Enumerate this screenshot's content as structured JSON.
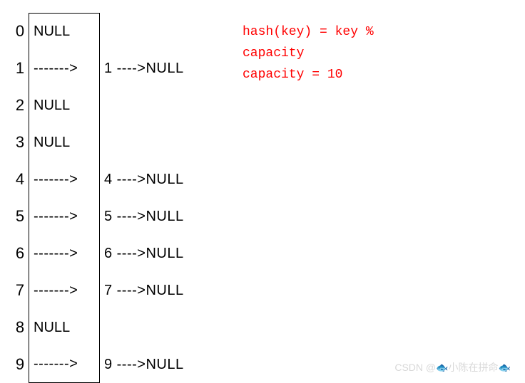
{
  "table": {
    "buckets": [
      {
        "index": "0",
        "content": "NULL",
        "has_chain": false
      },
      {
        "index": "1",
        "content": "",
        "has_chain": true,
        "arrow_in": "------->",
        "node": "1",
        "arrow_out": "---->",
        "tail": "NULL"
      },
      {
        "index": "2",
        "content": "NULL",
        "has_chain": false
      },
      {
        "index": "3",
        "content": "NULL",
        "has_chain": false
      },
      {
        "index": "4",
        "content": "",
        "has_chain": true,
        "arrow_in": "------->",
        "node": "4",
        "arrow_out": "---->",
        "tail": "NULL"
      },
      {
        "index": "5",
        "content": "",
        "has_chain": true,
        "arrow_in": "------->",
        "node": "5",
        "arrow_out": "---->",
        "tail": "NULL"
      },
      {
        "index": "6",
        "content": "",
        "has_chain": true,
        "arrow_in": "------->",
        "node": "6",
        "arrow_out": "---->",
        "tail": "NULL"
      },
      {
        "index": "7",
        "content": "",
        "has_chain": true,
        "arrow_in": "------->",
        "node": "7",
        "arrow_out": "---->",
        "tail": "NULL"
      },
      {
        "index": "8",
        "content": "NULL",
        "has_chain": false
      },
      {
        "index": "9",
        "content": "",
        "has_chain": true,
        "arrow_in": "------->",
        "node": "9",
        "arrow_out": "---->",
        "tail": "NULL"
      }
    ]
  },
  "formula": {
    "line1": "hash(key) = key %",
    "line2": "capacity",
    "line3": "capacity = 10"
  },
  "watermark": "CSDN @🐟小陈在拼命🐟"
}
